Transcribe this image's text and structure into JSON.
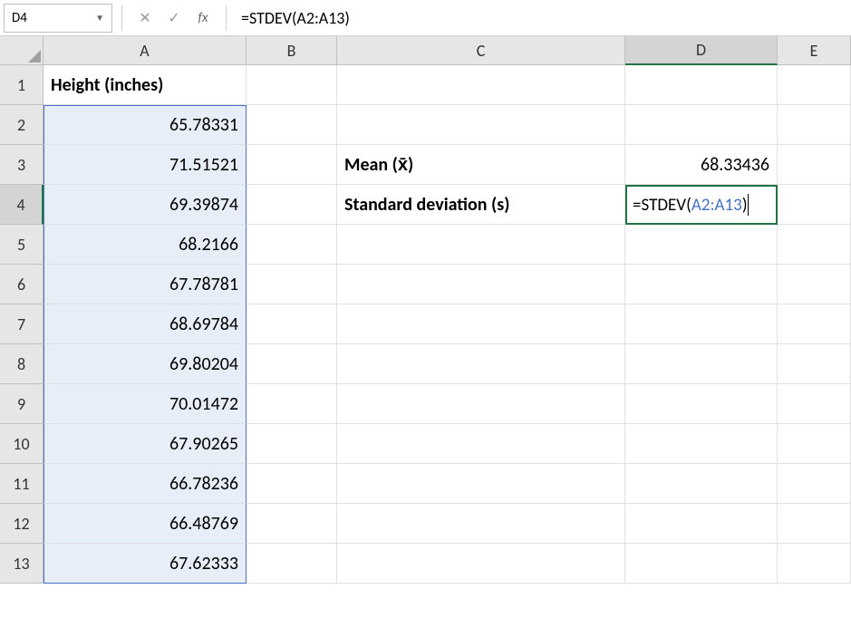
{
  "formula_bar": {
    "name_box": "D4",
    "formula": "=STDEV(A2:A13)"
  },
  "columns": [
    "A",
    "B",
    "C",
    "D",
    "E"
  ],
  "rows": [
    "1",
    "2",
    "3",
    "4",
    "5",
    "6",
    "7",
    "8",
    "9",
    "10",
    "11",
    "12",
    "13"
  ],
  "cells": {
    "a1": "Height (inches)",
    "a2": "65.78331",
    "a3": "71.51521",
    "a4": "69.39874",
    "a5": "68.2166",
    "a6": "67.78781",
    "a7": "68.69784",
    "a8": "69.80204",
    "a9": "70.01472",
    "a10": "67.90265",
    "a11": "66.78236",
    "a12": "66.48769",
    "a13": "67.62333",
    "c3": "Mean (x̄)",
    "c4": "Standard deviation (s)",
    "d3": "68.33436",
    "d4_prefix": "=STDEV(",
    "d4_ref": "A2:A13",
    "d4_suffix": ")"
  },
  "active_cell": "D4",
  "selected_range": "A2:A13"
}
